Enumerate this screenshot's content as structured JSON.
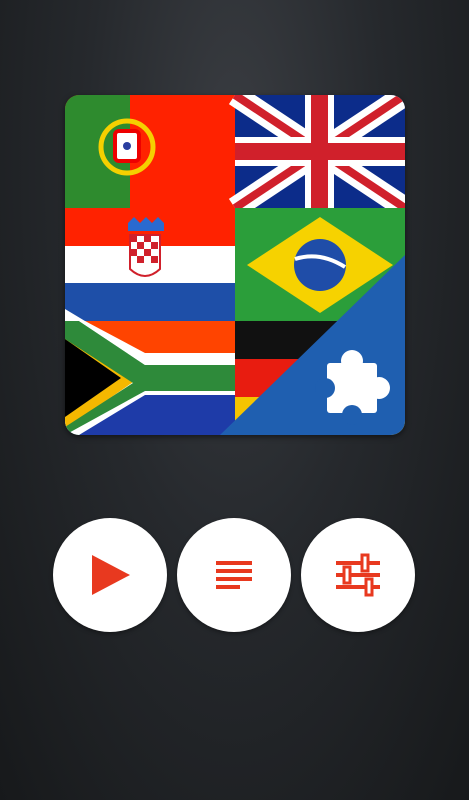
{
  "app": {
    "logo_icon": "flags-puzzle-logo",
    "accent_color": "#e8391f"
  },
  "buttons": [
    {
      "id": "play",
      "icon": "play-icon"
    },
    {
      "id": "list",
      "icon": "list-icon"
    },
    {
      "id": "settings",
      "icon": "sliders-icon"
    }
  ]
}
